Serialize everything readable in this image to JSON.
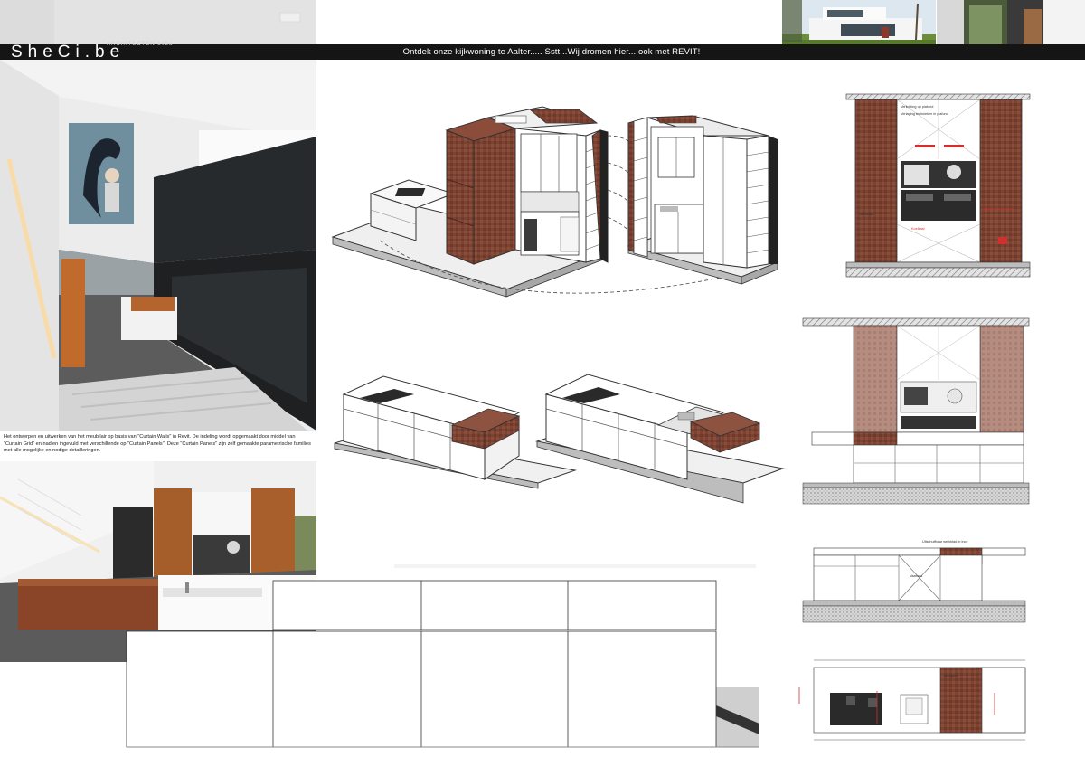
{
  "banner": {
    "text": "Ontdek onze kijkwoning te Aalter..... Sstt...Wij dromen hier....ook met REVIT!",
    "logo": "SheCi.be",
    "logo_sub": "ARCHITECTEN bvba"
  },
  "caption": "Het ontwerpen en uitwerken van het meubilair op basis van \"Curtain Walls\" in Revit. De indeling wordt opgemaakt door middel van \"Curtain Grid\" en nadien ingevuld met verschillende op \"Curtain Panels\". Deze \"Curtain Panels\" zijn zelf gemaakte parametrische families met alle mogelijke en nodige detailleringen.",
  "drawing_notes": {
    "note_a": "Verlichting op plafond",
    "note_b": "Verlaging technieken in plafond",
    "note_c": "Werkblad / Koof",
    "note_d": "Verlaging / techniek",
    "note_e": "Dakfolie / Stoomoven",
    "note_f": "Koelkast",
    "note_g": "Werkkast",
    "note_h": "Uitschuifbaar werkblad in inox",
    "note_i": "Vaatwas",
    "note_j": "Afzuiging"
  },
  "colors": {
    "wood": "#7d4332",
    "wood_light": "#a97463",
    "banner": "#151515",
    "line": "#333333",
    "hatch": "#777777",
    "red_annotation": "#d0312d"
  }
}
